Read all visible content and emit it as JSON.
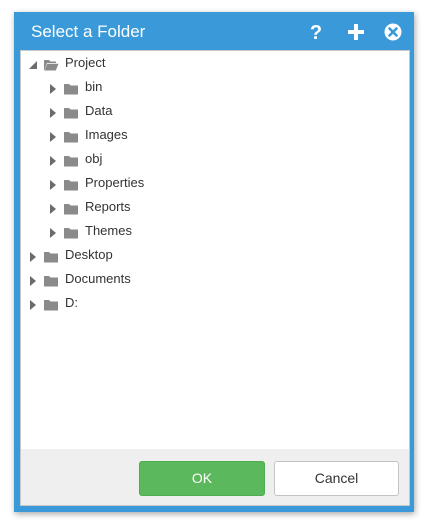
{
  "dialog": {
    "title": "Select a Folder",
    "accent_color": "#3a9ad9",
    "header_icons": [
      "help-icon",
      "add-icon",
      "close-icon"
    ]
  },
  "tree": {
    "nodes": [
      {
        "label": "Project",
        "level": 0,
        "state": "expanded",
        "icon": "folder-open-icon"
      },
      {
        "label": "bin",
        "level": 1,
        "state": "collapsed",
        "icon": "folder-icon"
      },
      {
        "label": "Data",
        "level": 1,
        "state": "collapsed",
        "icon": "folder-icon"
      },
      {
        "label": "Images",
        "level": 1,
        "state": "collapsed",
        "icon": "folder-icon"
      },
      {
        "label": "obj",
        "level": 1,
        "state": "collapsed",
        "icon": "folder-icon"
      },
      {
        "label": "Properties",
        "level": 1,
        "state": "collapsed",
        "icon": "folder-icon"
      },
      {
        "label": "Reports",
        "level": 1,
        "state": "collapsed",
        "icon": "folder-icon"
      },
      {
        "label": "Themes",
        "level": 1,
        "state": "collapsed",
        "icon": "folder-icon"
      },
      {
        "label": "Desktop",
        "level": 0,
        "state": "collapsed",
        "icon": "folder-icon"
      },
      {
        "label": "Documents",
        "level": 0,
        "state": "collapsed",
        "icon": "folder-icon"
      },
      {
        "label": "D:",
        "level": 0,
        "state": "collapsed",
        "icon": "folder-icon"
      }
    ]
  },
  "buttons": {
    "ok": {
      "label": "OK",
      "color": "#5cb85c"
    },
    "cancel": {
      "label": "Cancel"
    }
  }
}
